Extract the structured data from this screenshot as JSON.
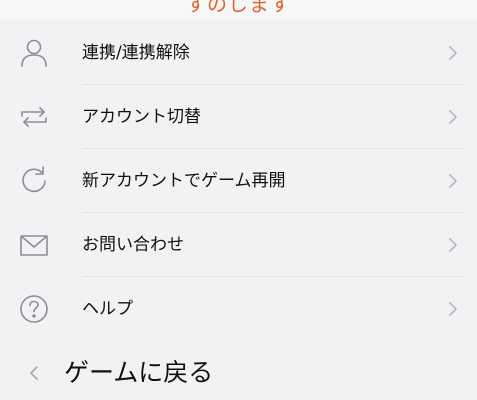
{
  "header": {
    "partial_text": "すのします"
  },
  "menu": {
    "items": [
      {
        "label": "連携/連携解除",
        "icon": "user-icon"
      },
      {
        "label": "アカウント切替",
        "icon": "switch-arrows-icon"
      },
      {
        "label": "新アカウントでゲーム再開",
        "icon": "refresh-icon"
      },
      {
        "label": "お問い合わせ",
        "icon": "mail-icon"
      },
      {
        "label": "ヘルプ",
        "icon": "help-icon"
      }
    ]
  },
  "footer": {
    "back_label": "ゲームに戻る"
  },
  "colors": {
    "accent": "#e2642d",
    "background": "#f2f2f4",
    "icon": "#8e8e93",
    "chevron": "#b8b8bc",
    "text": "#111111"
  }
}
